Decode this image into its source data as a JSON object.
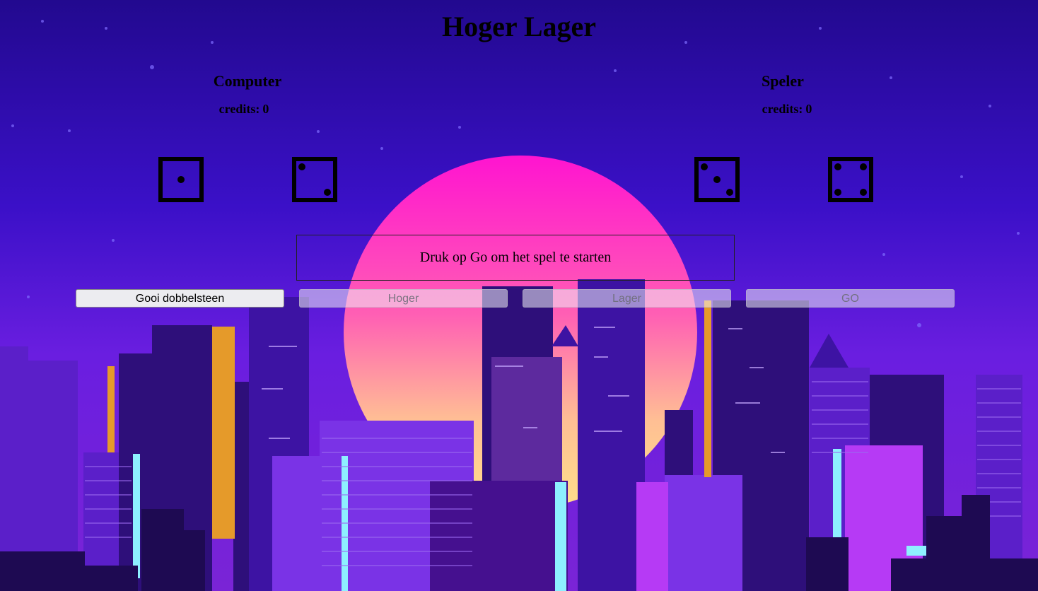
{
  "page": {
    "title": "Hoger Lager"
  },
  "computer": {
    "heading": "Computer",
    "credits_label": "credits:",
    "credits_value": "0",
    "dice": [
      1,
      2
    ]
  },
  "speler": {
    "heading": "Speler",
    "credits_label": "credits:",
    "credits_value": "0",
    "dice": [
      3,
      4
    ]
  },
  "message": "Druk op Go om het spel te starten",
  "buttons": {
    "gooi": "Gooi dobbelsteen",
    "hoger": "Hoger",
    "lager": "Lager",
    "go": "GO"
  },
  "colors": {
    "sky_top": "#22098f",
    "sun_top": "#ff1fcf",
    "sun_bottom": "#ffd88a",
    "building_dark": "#2a0d6e",
    "building_mid": "#6a2bd8",
    "accent_orange": "#e59a2a",
    "accent_cyan": "#8ef0ff"
  }
}
